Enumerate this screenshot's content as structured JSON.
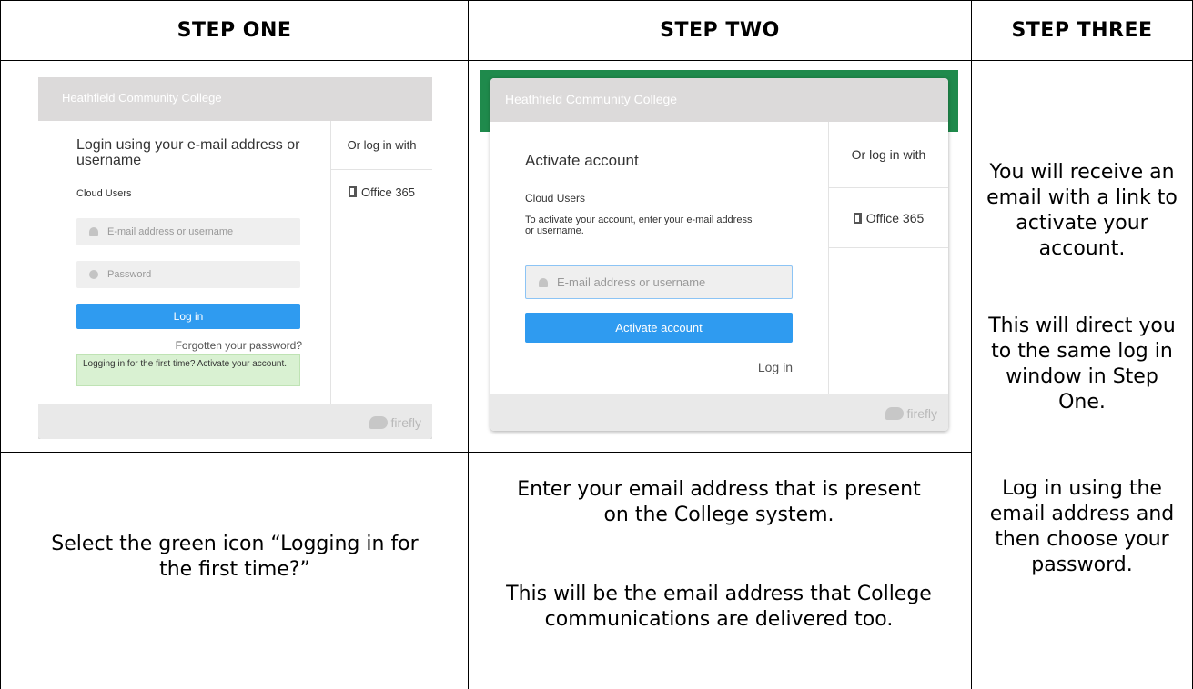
{
  "headers": {
    "step_one": "STEP ONE",
    "step_two": "STEP TWO",
    "step_three": "STEP THREE"
  },
  "step_one_screen": {
    "college_name": "Heathfield Community College",
    "heading": "Login using your e-mail address or username",
    "section": "Cloud Users",
    "email_placeholder": "E-mail address or username",
    "password_placeholder": "Password",
    "login_button": "Log in",
    "forgot_link": "Forgotten your password?",
    "first_time_notice": "Logging in for the first time? Activate your account.",
    "or_log_in_with": "Or log in with",
    "office365": "Office 365",
    "brand": "firefly",
    "icons": {
      "email": "user-icon",
      "password": "lock-icon",
      "office": "office365-icon",
      "brand": "firefly-logo-icon"
    }
  },
  "step_two_screen": {
    "college_name": "Heathfield Community College",
    "heading": "Activate account",
    "section": "Cloud Users",
    "instruction": "To activate your account, enter your e-mail address or username.",
    "email_placeholder": "E-mail address or username",
    "activate_button": "Activate account",
    "login_link": "Log in",
    "or_log_in_with": "Or log in with",
    "office365": "Office 365",
    "brand": "firefly"
  },
  "descriptions": {
    "step_one": "Select the green icon “Logging in for the first time?”",
    "step_two_p1": "Enter your email address that is present on the College system.",
    "step_two_p2": "This will be the email address that College communications are delivered too.",
    "step_three_p1": "You will receive an email with a link to activate your account.",
    "step_three_p2": "This will direct you to the same log in window in Step One.",
    "step_three_p3": "Log in using the email address and then choose your password."
  },
  "colors": {
    "college_green": "#1f8a4c",
    "button_blue": "#2f9bf0",
    "notice_green": "#d9f1d2"
  }
}
